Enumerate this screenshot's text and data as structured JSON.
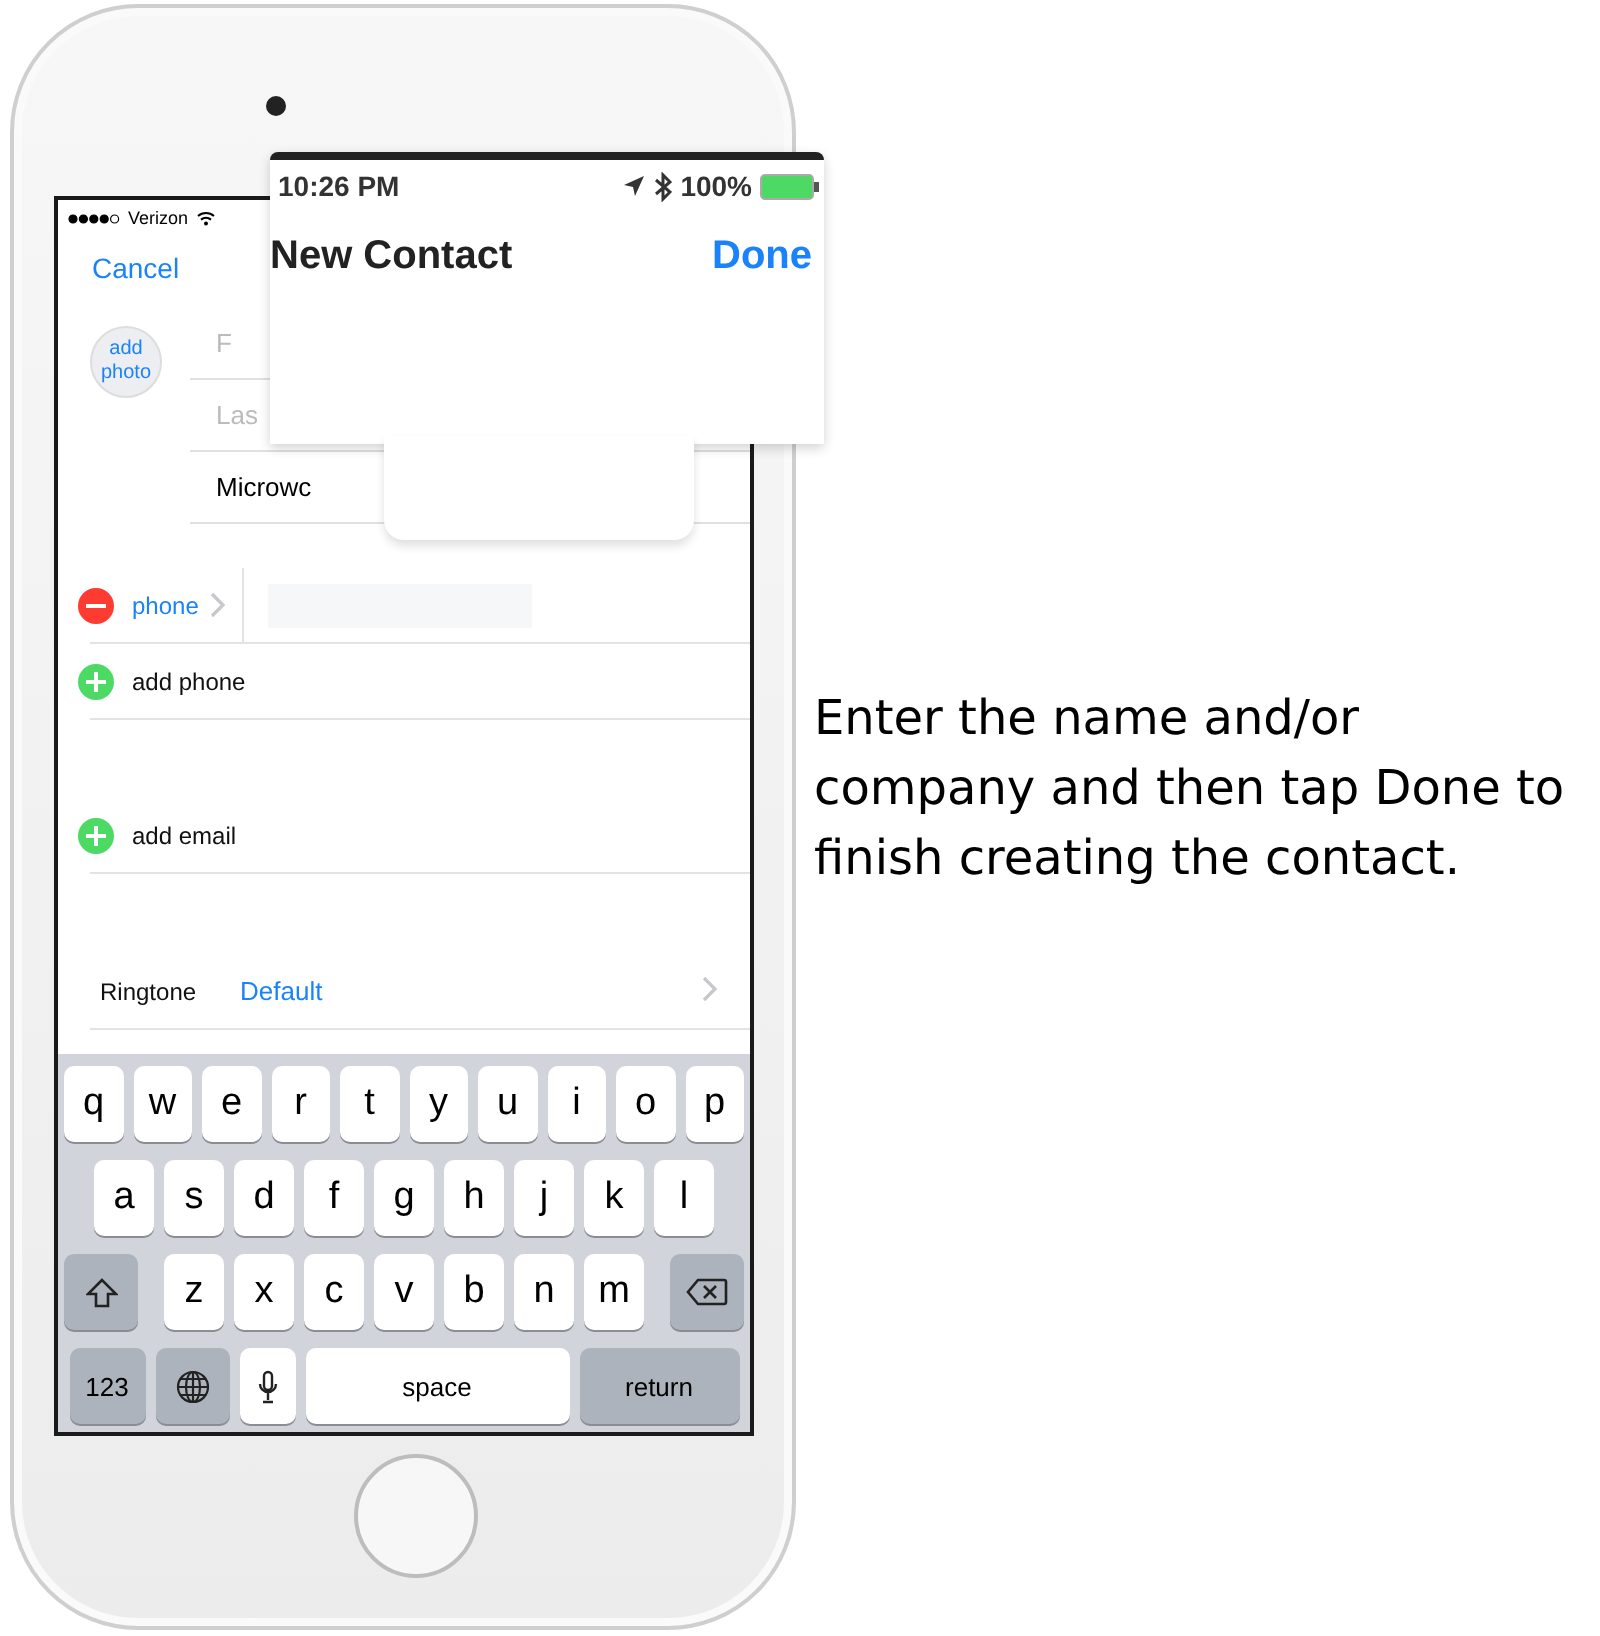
{
  "magnifier": {
    "time": "10:26 PM",
    "battery": "100%",
    "title": "New Contact",
    "done": "Done"
  },
  "status_bar": {
    "carrier": "Verizon"
  },
  "nav": {
    "cancel": "Cancel"
  },
  "photo": {
    "label": "add photo"
  },
  "name_fields": [
    {
      "placeholder": "F"
    },
    {
      "placeholder": "Las"
    },
    {
      "value": "Microwc"
    }
  ],
  "rows": [
    {
      "kind": "remove",
      "label": "phone"
    },
    {
      "kind": "add",
      "label": "add phone"
    },
    {
      "kind": "add",
      "label": "add email"
    },
    {
      "kind": "link",
      "label": "Ringtone",
      "value": "Default"
    }
  ],
  "keyboard": {
    "rows": [
      {
        "keys": [
          {
            "kind": "letter",
            "label": "q"
          },
          {
            "kind": "letter",
            "label": "w"
          },
          {
            "kind": "letter",
            "label": "e"
          },
          {
            "kind": "letter",
            "label": "r"
          },
          {
            "kind": "letter",
            "label": "t"
          },
          {
            "kind": "letter",
            "label": "y"
          },
          {
            "kind": "letter",
            "label": "u"
          },
          {
            "kind": "letter",
            "label": "i"
          },
          {
            "kind": "letter",
            "label": "o"
          },
          {
            "kind": "letter",
            "label": "p"
          }
        ]
      },
      {
        "keys": [
          {
            "kind": "letter",
            "label": "a"
          },
          {
            "kind": "letter",
            "label": "s"
          },
          {
            "kind": "letter",
            "label": "d"
          },
          {
            "kind": "letter",
            "label": "f"
          },
          {
            "kind": "letter",
            "label": "g"
          },
          {
            "kind": "letter",
            "label": "h"
          },
          {
            "kind": "letter",
            "label": "j"
          },
          {
            "kind": "letter",
            "label": "k"
          },
          {
            "kind": "letter",
            "label": "l"
          }
        ]
      },
      {
        "keys": [
          {
            "kind": "shift"
          },
          {
            "kind": "letter",
            "label": "z"
          },
          {
            "kind": "letter",
            "label": "x"
          },
          {
            "kind": "letter",
            "label": "c"
          },
          {
            "kind": "letter",
            "label": "v"
          },
          {
            "kind": "letter",
            "label": "b"
          },
          {
            "kind": "letter",
            "label": "n"
          },
          {
            "kind": "letter",
            "label": "m"
          },
          {
            "kind": "delete"
          }
        ]
      },
      {
        "keys": [
          {
            "kind": "numbers",
            "label": "123"
          },
          {
            "kind": "globe"
          },
          {
            "kind": "mic"
          },
          {
            "kind": "space",
            "label": "space"
          },
          {
            "kind": "return",
            "label": "return"
          }
        ]
      }
    ]
  },
  "caption": "Enter the name and/or company and then tap Done to finish creating the contact."
}
